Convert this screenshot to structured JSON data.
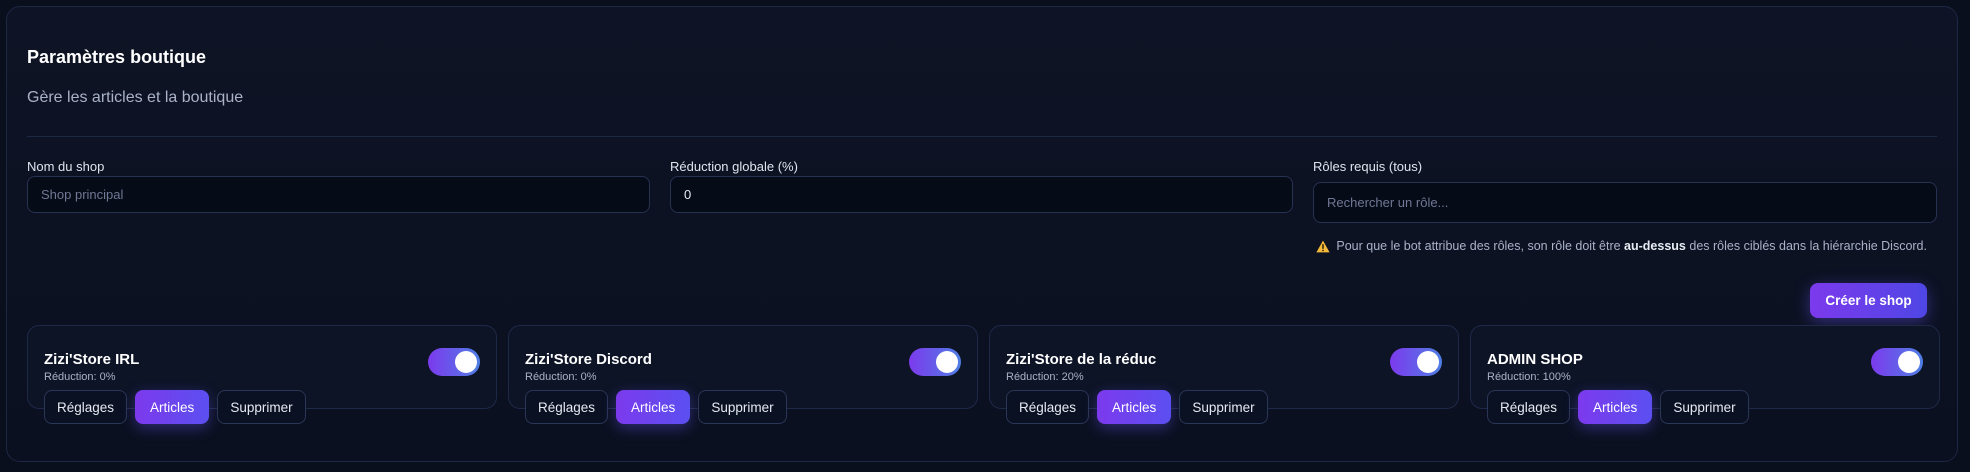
{
  "header": {
    "title": "Paramètres boutique",
    "subtitle": "Gère les articles et la boutique"
  },
  "form": {
    "shop_name": {
      "label": "Nom du shop",
      "placeholder": "Shop principal",
      "value": ""
    },
    "global_reduction": {
      "label": "Réduction globale (%)",
      "value": "0"
    },
    "roles": {
      "label": "Rôles requis (tous)",
      "placeholder": "Rechercher un rôle..."
    },
    "hint": {
      "before": "Pour que le bot attribue des rôles, son rôle doit être",
      "bold": "au-dessus",
      "after": "des rôles ciblés dans la hiérarchie Discord."
    },
    "create_label": "Créer le shop"
  },
  "shop_buttons": {
    "settings": "Réglages",
    "articles": "Articles",
    "delete": "Supprimer"
  },
  "shops": [
    {
      "name": "Zizi'Store IRL",
      "reduction": "Réduction: 0%",
      "enabled": true
    },
    {
      "name": "Zizi'Store Discord",
      "reduction": "Réduction: 0%",
      "enabled": true
    },
    {
      "name": "Zizi'Store de la réduc",
      "reduction": "Réduction: 20%",
      "enabled": true
    },
    {
      "name": "ADMIN SHOP",
      "reduction": "Réduction: 100%",
      "enabled": true
    }
  ],
  "colors": {
    "accent": "#7c3aed",
    "accent_2": "#4f46e5",
    "background": "#0a0f1e",
    "warning": "#f5b93a"
  },
  "icons": {
    "hint": "warning-icon"
  }
}
